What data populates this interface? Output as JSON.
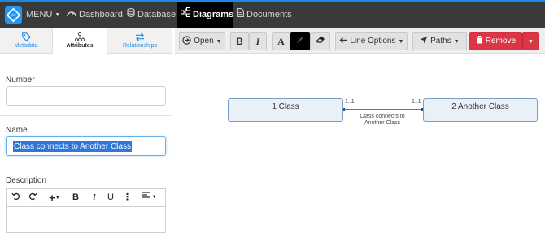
{
  "topnav": {
    "menu_label": "MENU",
    "items": [
      {
        "label": "Dashboard",
        "icon": "speedometer-icon"
      },
      {
        "label": "Database",
        "icon": "database-icon"
      },
      {
        "label": "Diagrams",
        "icon": "diagram-icon"
      },
      {
        "label": "Documents",
        "icon": "document-icon"
      }
    ],
    "active_item": "Diagrams",
    "accent_color": "#1e88e5"
  },
  "sidebar": {
    "tabs": [
      {
        "label": "Metadata",
        "icon": "tag-icon"
      },
      {
        "label": "Attributes",
        "icon": "sitemap-icon"
      },
      {
        "label": "Relationships",
        "icon": "swap-icon"
      }
    ],
    "active_tab": "Attributes",
    "fields": {
      "number_label": "Number",
      "number_value": "",
      "name_label": "Name",
      "name_value": "Class connects to Another Class",
      "description_label": "Description"
    },
    "editor_toolbar": [
      "undo",
      "redo",
      "insert",
      "bold",
      "italic",
      "underline",
      "more",
      "align"
    ]
  },
  "toolbar": {
    "open_label": "Open",
    "bold_label": "B",
    "italic_label": "I",
    "font_color_label": "A",
    "line_options_label": "Line Options",
    "paths_label": "Paths",
    "remove_label": "Remove",
    "remove_color": "#dc3545"
  },
  "diagram": {
    "class1": "1 Class",
    "class2": "2 Another Class",
    "mult_left": "1..1",
    "mult_right": "1..1",
    "association_label": "Class connects to Another Class",
    "line_color": "#1f4e8c"
  }
}
